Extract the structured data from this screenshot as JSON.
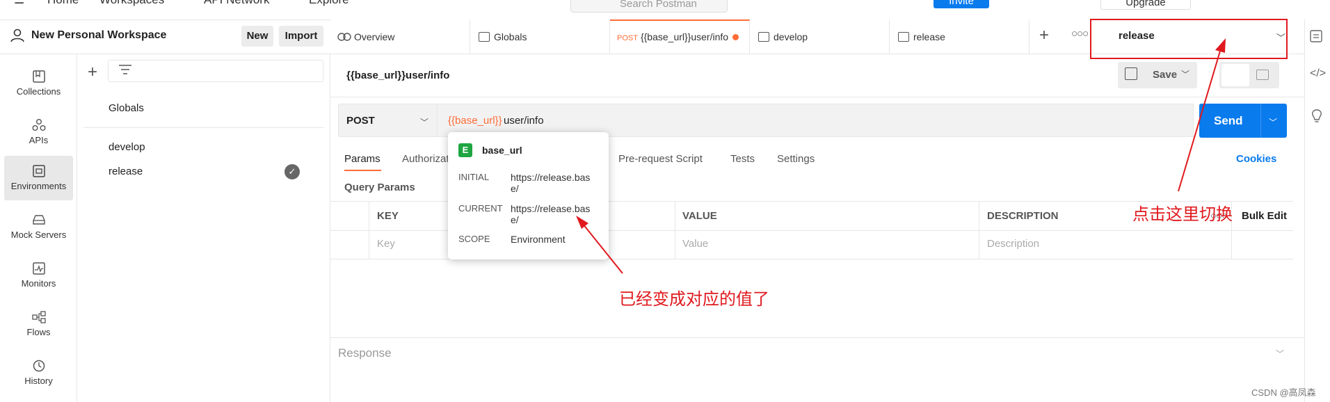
{
  "topbar": {
    "home": "Home",
    "workspaces": "Workspaces",
    "api_network": "API Network",
    "explore": "Explore",
    "search_placeholder": "Search Postman",
    "invite": "Invite",
    "upgrade": "Upgrade"
  },
  "workspace": {
    "name": "New Personal Workspace",
    "new_label": "New",
    "import_label": "Import"
  },
  "nav": {
    "items": [
      {
        "label": "Collections",
        "icon": "collections-icon"
      },
      {
        "label": "APIs",
        "icon": "apis-icon"
      },
      {
        "label": "Environments",
        "icon": "environments-icon",
        "active": true
      },
      {
        "label": "Mock Servers",
        "icon": "mock-servers-icon"
      },
      {
        "label": "Monitors",
        "icon": "monitors-icon"
      },
      {
        "label": "Flows",
        "icon": "flows-icon"
      },
      {
        "label": "History",
        "icon": "history-icon"
      }
    ]
  },
  "environments": {
    "globals": "Globals",
    "items": [
      "develop",
      "release"
    ],
    "active": "release"
  },
  "tabs": {
    "overview": "Overview",
    "globals": "Globals",
    "request_method": "POST",
    "request": "{{base_url}}user/info",
    "develop": "develop",
    "release": "release",
    "accent": "#ff6c37"
  },
  "env_selector": {
    "value": "release"
  },
  "request": {
    "title": "{{base_url}}user/info",
    "save_label": "Save",
    "method": "POST",
    "url_variable": "{{base_url}}",
    "url_path": "user/info",
    "send_label": "Send",
    "send_color": "#097bed"
  },
  "subtabs": {
    "params": "Params",
    "authorization": "Authorization",
    "prerequest": "Pre-request Script",
    "tests": "Tests",
    "settings": "Settings",
    "cookies": "Cookies"
  },
  "query_params": {
    "label": "Query Params",
    "headers": [
      "KEY",
      "VALUE",
      "DESCRIPTION"
    ],
    "placeholders": [
      "Key",
      "Value",
      "Description"
    ],
    "bulk_edit": "Bulk Edit"
  },
  "response": {
    "label": "Response"
  },
  "tooltip": {
    "badge": "E",
    "name": "base_url",
    "rows": [
      {
        "label": "INITIAL",
        "value": "https://release.base/"
      },
      {
        "label": "CURRENT",
        "value": "https://release.base/"
      },
      {
        "label": "SCOPE",
        "value": "Environment"
      }
    ]
  },
  "annotations": {
    "switch_here": "点击这里切换",
    "value_changed": "已经变成对应的值了",
    "color": "#e0191e"
  },
  "watermark": "CSDN @高凤森"
}
